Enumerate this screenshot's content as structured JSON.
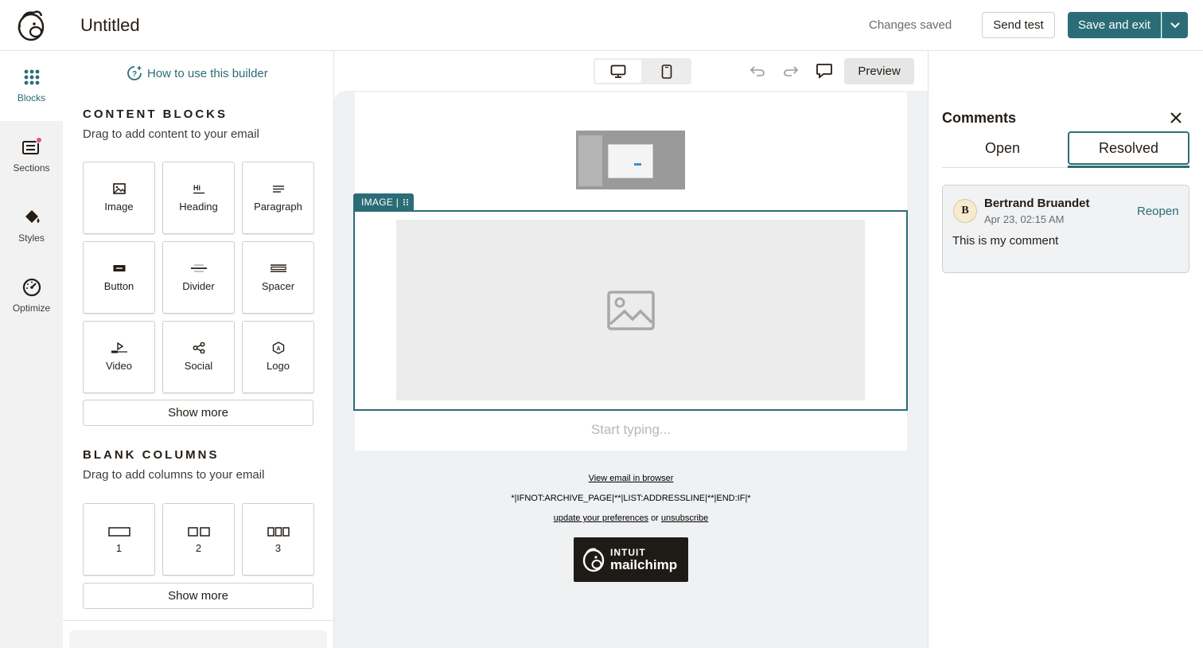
{
  "header": {
    "title": "Untitled",
    "status": "Changes saved",
    "send_test_label": "Send test",
    "save_exit_label": "Save and exit"
  },
  "rail": {
    "items": [
      {
        "label": "Blocks",
        "icon": "grid-dots-icon",
        "active": true
      },
      {
        "label": "Sections",
        "icon": "sections-icon",
        "badge": true
      },
      {
        "label": "Styles",
        "icon": "paint-bucket-icon"
      },
      {
        "label": "Optimize",
        "icon": "gauge-icon"
      }
    ]
  },
  "panel": {
    "howto_label": "How to use this builder",
    "content_blocks": {
      "heading": "CONTENT BLOCKS",
      "subtitle": "Drag to add content to your email",
      "tiles": [
        {
          "label": "Image",
          "icon": "image-icon"
        },
        {
          "label": "Heading",
          "icon": "heading-icon"
        },
        {
          "label": "Paragraph",
          "icon": "paragraph-icon"
        },
        {
          "label": "Button",
          "icon": "button-icon"
        },
        {
          "label": "Divider",
          "icon": "divider-icon"
        },
        {
          "label": "Spacer",
          "icon": "spacer-icon"
        },
        {
          "label": "Video",
          "icon": "video-icon"
        },
        {
          "label": "Social",
          "icon": "share-icon"
        },
        {
          "label": "Logo",
          "icon": "logo-icon"
        }
      ],
      "show_more": "Show more"
    },
    "blank_columns": {
      "heading": "BLANK COLUMNS",
      "subtitle": "Drag to add columns to your email",
      "tiles": [
        {
          "label": "1",
          "icon": "one-column-icon"
        },
        {
          "label": "2",
          "icon": "two-column-icon"
        },
        {
          "label": "3",
          "icon": "three-column-icon"
        }
      ],
      "show_more": "Show more"
    }
  },
  "toolbar": {
    "preview_label": "Preview"
  },
  "canvas": {
    "image_tag": "IMAGE |",
    "start_typing": "Start typing...",
    "footer": {
      "view_in_browser": "View email in browser",
      "merge_tags": "*|IFNOT:ARCHIVE_PAGE|**|LIST:ADDRESSLINE|**|END:IF|*",
      "update_prefs": "update your preferences",
      "or": "or",
      "unsubscribe": "unsubscribe",
      "badge_line1": "INTUIT",
      "badge_line2": "mailchimp"
    }
  },
  "comments": {
    "title": "Comments",
    "tabs": [
      "Open",
      "Resolved"
    ],
    "active_tab": "Resolved",
    "items": [
      {
        "initial": "B",
        "author": "Bertrand Bruandet",
        "date": "Apr 23, 02:15 AM",
        "action": "Reopen",
        "body": "This is my comment"
      }
    ]
  },
  "colors": {
    "accent": "#2b6d76",
    "badge_pink": "#e0559a",
    "canvas_bg": "#f0f1f3"
  }
}
